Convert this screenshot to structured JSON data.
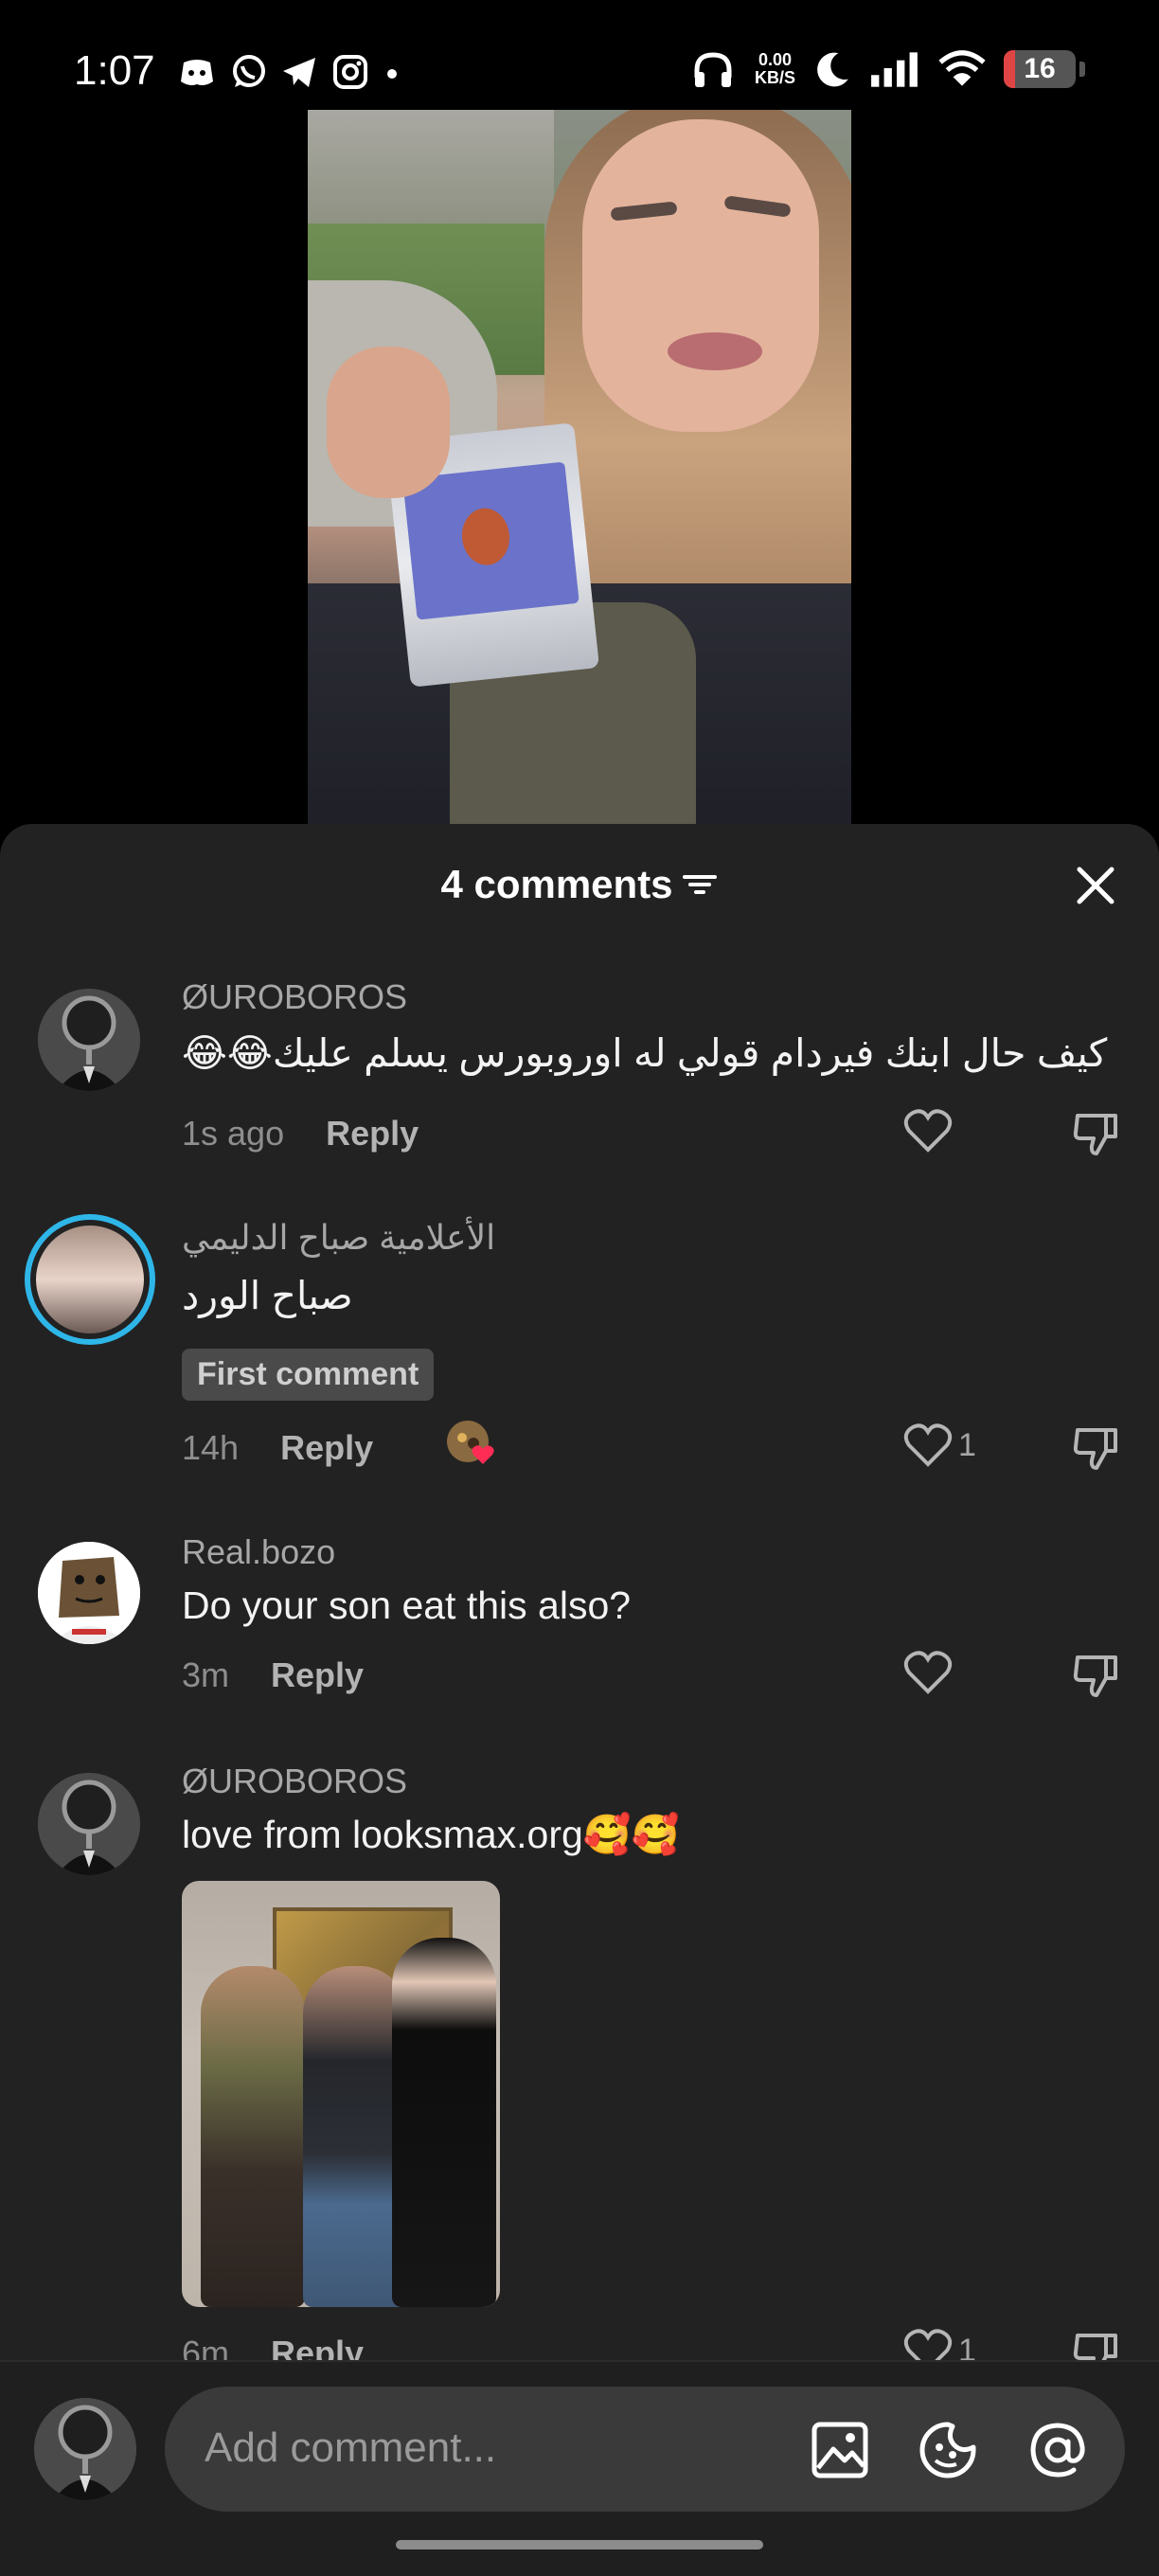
{
  "status_bar": {
    "time": "1:07",
    "speed_value": "0.00",
    "speed_unit": "KB/S",
    "battery": "16",
    "battery_level": 0.16
  },
  "sheet": {
    "title": "4 comments"
  },
  "comments": [
    {
      "user": "ØUROBOROS",
      "text": "كيف حال ابنك فيردام قولي له اوروبورس يسلم عليك😂😂",
      "time": "1s ago",
      "reply": "Reply",
      "likes": ""
    },
    {
      "user": "الأعلامية صباح الدليمي",
      "text": "صباح الورد",
      "badge": "First comment",
      "time": "14h",
      "reply": "Reply",
      "likes": "1"
    },
    {
      "user": "Real.bozo",
      "text": "Do your son eat this also?",
      "time": "3m",
      "reply": "Reply",
      "likes": ""
    },
    {
      "user": "ØUROBOROS",
      "text": "love from looksmax.org🥰🥰",
      "time": "6m",
      "reply": "Reply",
      "likes": "1"
    }
  ],
  "composer": {
    "placeholder": "Add comment..."
  },
  "colors": {
    "sheet_bg": "#222222",
    "story_ring": "#2fb6e8",
    "battery_low": "#e04545"
  }
}
